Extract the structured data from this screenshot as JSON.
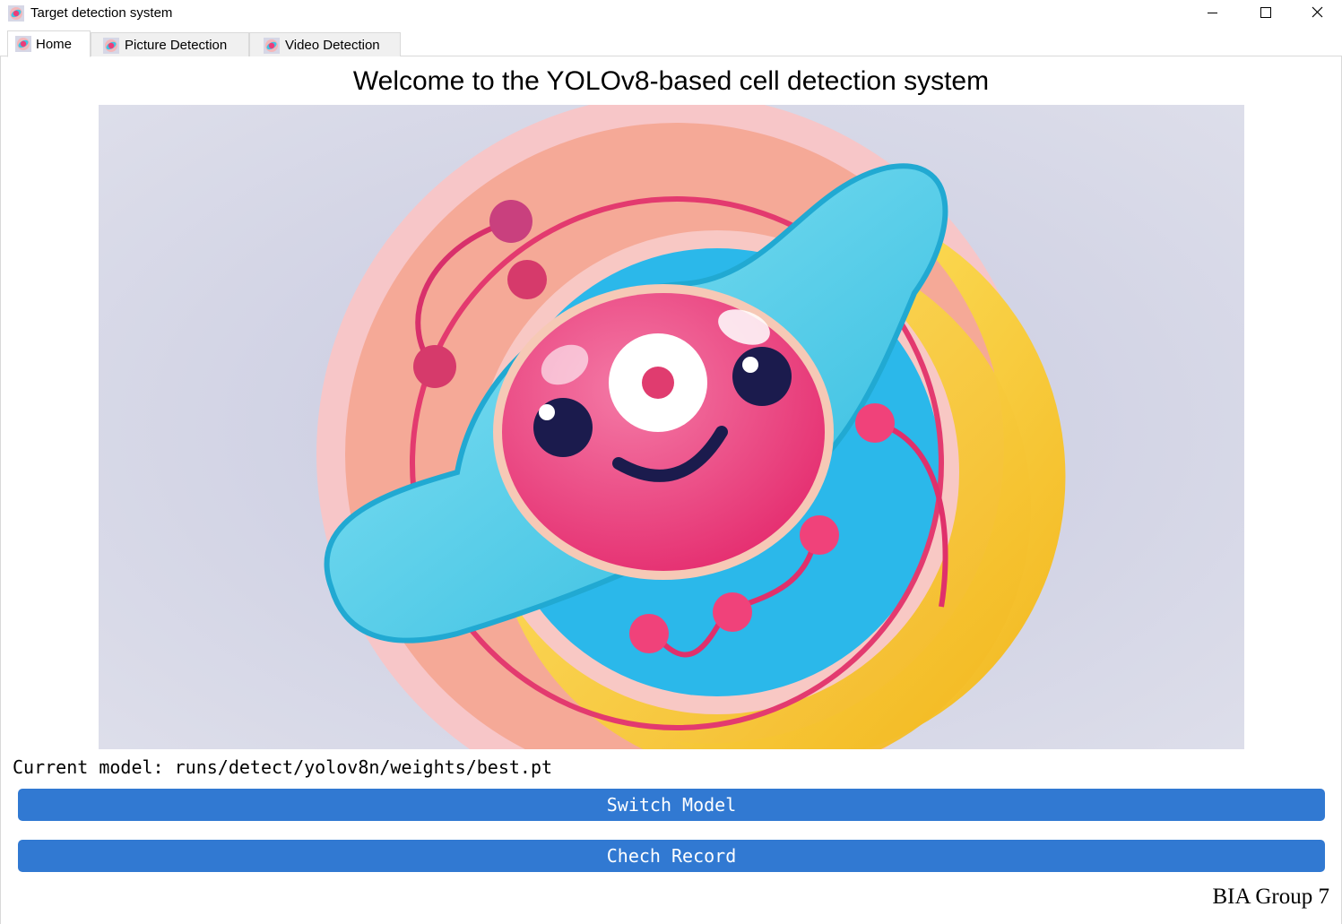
{
  "window": {
    "title": "Target detection system",
    "icon": "cell-app-icon",
    "controls": [
      "minimize-icon",
      "maximize-icon",
      "close-icon"
    ]
  },
  "tabs": [
    {
      "label": "Home",
      "active": true,
      "icon": "cell-app-icon"
    },
    {
      "label": "Picture Detection",
      "active": false,
      "icon": "cell-app-icon"
    },
    {
      "label": "Video Detection",
      "active": false,
      "icon": "cell-app-icon"
    }
  ],
  "home": {
    "heading": "Welcome to the YOLOv8-based cell detection system",
    "illustration": "cartoon-cell-illustration",
    "current_model": "Current model: runs/detect/yolov8n/weights/best.pt",
    "switch_model_label": "Switch Model",
    "check_record_label": "Chech Record",
    "footer": "BIA Group 7"
  },
  "colors": {
    "button": "#3179d2",
    "button_text": "#ffffff",
    "hero_background": "#d3d5e6",
    "cell_pink": "#ec3c78",
    "cell_cyan": "#3fc6e4",
    "cell_yellow": "#f7cf2a"
  }
}
